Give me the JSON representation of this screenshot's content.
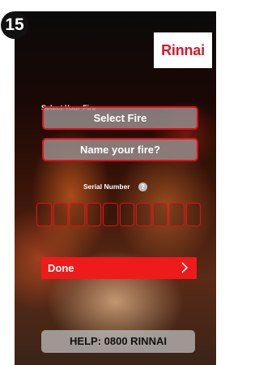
{
  "step": {
    "number": "15"
  },
  "brand": {
    "logo_text": "Rinnai"
  },
  "form": {
    "section_label": "Select Your Fire",
    "select_fire_label": "Select Fire",
    "name_fire_label": "Name your fire?",
    "serial_label": "Serial Number",
    "serial_help_symbol": "?",
    "serial_box_count": 10
  },
  "actions": {
    "done_label": "Done",
    "help_label": "HELP: 0800 RINNAI"
  },
  "colors": {
    "accent_red": "#e0101a",
    "done_red": "#ef1a1a",
    "brand_red": "#d6182a"
  }
}
